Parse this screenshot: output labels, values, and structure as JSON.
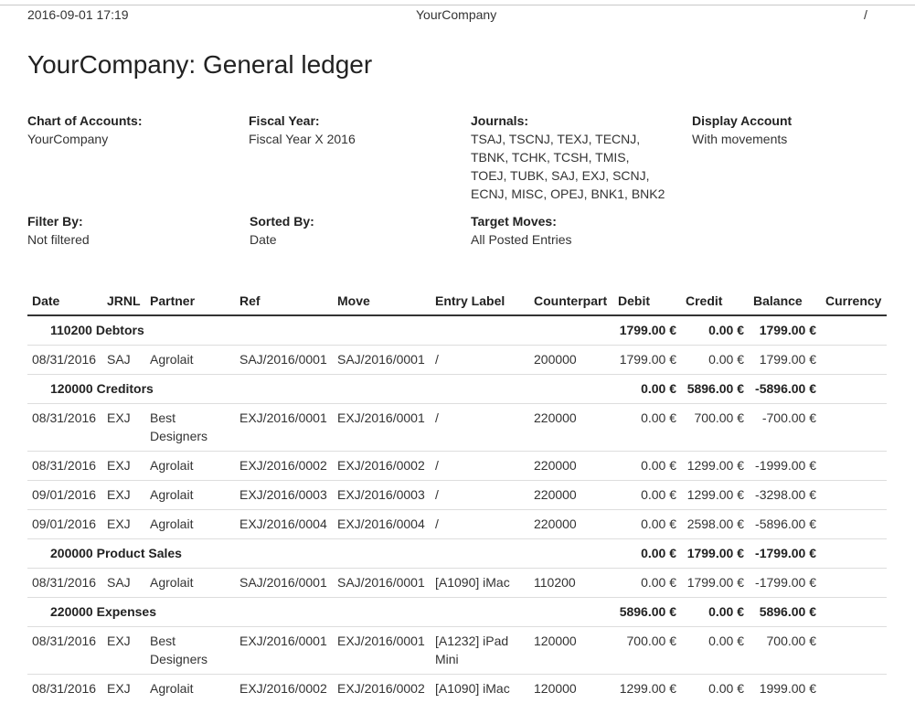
{
  "header": {
    "datetime": "2016-09-01 17:19",
    "company": "YourCompany",
    "page": "/"
  },
  "title": "YourCompany: General ledger",
  "filters": [
    {
      "label": "Chart of Accounts:",
      "value": "YourCompany"
    },
    {
      "label": "Fiscal Year:",
      "value": "Fiscal Year X 2016"
    },
    {
      "label": "Journals:",
      "value_lines": [
        "TSAJ, TSCNJ, TEXJ, TECNJ,",
        "TBNK, TCHK, TCSH, TMIS,",
        "TOEJ, TUBK, SAJ, EXJ, SCNJ,",
        "ECNJ, MISC, OPEJ, BNK1, BNK2"
      ]
    },
    {
      "label": "Display Account",
      "value": "With movements"
    },
    {
      "label": "Filter By:",
      "value": "Not filtered"
    },
    {
      "label": "Sorted By:",
      "value": "Date"
    },
    {
      "label": "Target Moves:",
      "value": "All Posted Entries"
    }
  ],
  "columns": [
    "Date",
    "JRNL",
    "Partner",
    "Ref",
    "Move",
    "Entry Label",
    "Counterpart",
    "Debit",
    "Credit",
    "Balance",
    "Currency"
  ],
  "rows": [
    {
      "type": "account",
      "name": "110200 Debtors",
      "debit": "1799.00 €",
      "credit": "0.00 €",
      "balance": "1799.00 €"
    },
    {
      "type": "line",
      "date": "08/31/2016",
      "jrnl": "SAJ",
      "partner": "Agrolait",
      "ref": "SAJ/2016/0001",
      "move": "SAJ/2016/0001",
      "label": "/",
      "counterpart": "200000",
      "debit": "1799.00 €",
      "credit": "0.00 €",
      "balance": "1799.00 €",
      "currency": ""
    },
    {
      "type": "account",
      "name": "120000 Creditors",
      "debit": "0.00 €",
      "credit": "5896.00 €",
      "balance": "-5896.00 €"
    },
    {
      "type": "line",
      "date": "08/31/2016",
      "jrnl": "EXJ",
      "partner": "Best Designers",
      "ref": "EXJ/2016/0001",
      "move": "EXJ/2016/0001",
      "label": "/",
      "counterpart": "220000",
      "debit": "0.00 €",
      "credit": "700.00 €",
      "balance": "-700.00 €",
      "currency": ""
    },
    {
      "type": "line",
      "date": "08/31/2016",
      "jrnl": "EXJ",
      "partner": "Agrolait",
      "ref": "EXJ/2016/0002",
      "move": "EXJ/2016/0002",
      "label": "/",
      "counterpart": "220000",
      "debit": "0.00 €",
      "credit": "1299.00 €",
      "balance": "-1999.00 €",
      "currency": ""
    },
    {
      "type": "line",
      "date": "09/01/2016",
      "jrnl": "EXJ",
      "partner": "Agrolait",
      "ref": "EXJ/2016/0003",
      "move": "EXJ/2016/0003",
      "label": "/",
      "counterpart": "220000",
      "debit": "0.00 €",
      "credit": "1299.00 €",
      "balance": "-3298.00 €",
      "currency": ""
    },
    {
      "type": "line",
      "date": "09/01/2016",
      "jrnl": "EXJ",
      "partner": "Agrolait",
      "ref": "EXJ/2016/0004",
      "move": "EXJ/2016/0004",
      "label": "/",
      "counterpart": "220000",
      "debit": "0.00 €",
      "credit": "2598.00 €",
      "balance": "-5896.00 €",
      "currency": ""
    },
    {
      "type": "account",
      "name": "200000 Product Sales",
      "debit": "0.00 €",
      "credit": "1799.00 €",
      "balance": "-1799.00 €"
    },
    {
      "type": "line",
      "date": "08/31/2016",
      "jrnl": "SAJ",
      "partner": "Agrolait",
      "ref": "SAJ/2016/0001",
      "move": "SAJ/2016/0001",
      "label": "[A1090] iMac",
      "counterpart": "110200",
      "debit": "0.00 €",
      "credit": "1799.00 €",
      "balance": "-1799.00 €",
      "currency": ""
    },
    {
      "type": "account",
      "name": "220000 Expenses",
      "debit": "5896.00 €",
      "credit": "0.00 €",
      "balance": "5896.00 €"
    },
    {
      "type": "line",
      "date": "08/31/2016",
      "jrnl": "EXJ",
      "partner": "Best Designers",
      "ref": "EXJ/2016/0001",
      "move": "EXJ/2016/0001",
      "label": "[A1232] iPad Mini",
      "counterpart": "120000",
      "debit": "700.00 €",
      "credit": "0.00 €",
      "balance": "700.00 €",
      "currency": ""
    },
    {
      "type": "line",
      "date": "08/31/2016",
      "jrnl": "EXJ",
      "partner": "Agrolait",
      "ref": "EXJ/2016/0002",
      "move": "EXJ/2016/0002",
      "label": "[A1090] iMac",
      "counterpart": "120000",
      "debit": "1299.00 €",
      "credit": "0.00 €",
      "balance": "1999.00 €",
      "currency": ""
    }
  ]
}
